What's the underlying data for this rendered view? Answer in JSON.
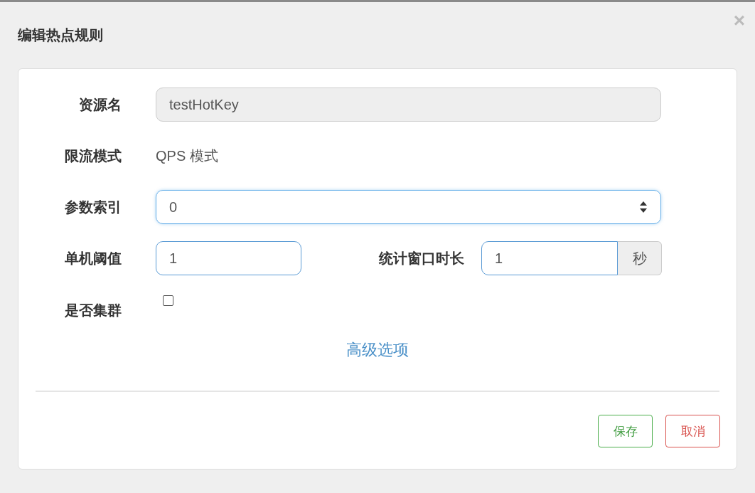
{
  "dialog": {
    "title": "编辑热点规则",
    "close": "×"
  },
  "fields": [
    {
      "kind": "readonly",
      "label": "资源名",
      "value": "testHotKey"
    },
    {
      "kind": "static",
      "label": "限流模式",
      "value": "QPS 模式"
    },
    {
      "kind": "number",
      "label": "参数索引",
      "value": "0"
    },
    {
      "kind": "pair",
      "label": "单机阈值",
      "value": "1",
      "label2": "统计窗口时长",
      "value2": "1",
      "addon": "秒"
    },
    {
      "kind": "checkbox",
      "label": "是否集群",
      "checked": false
    }
  ],
  "advanced_link": "高级选项",
  "buttons": [
    {
      "kind": "save",
      "label": "保存"
    },
    {
      "kind": "cancel",
      "label": "取消"
    }
  ]
}
